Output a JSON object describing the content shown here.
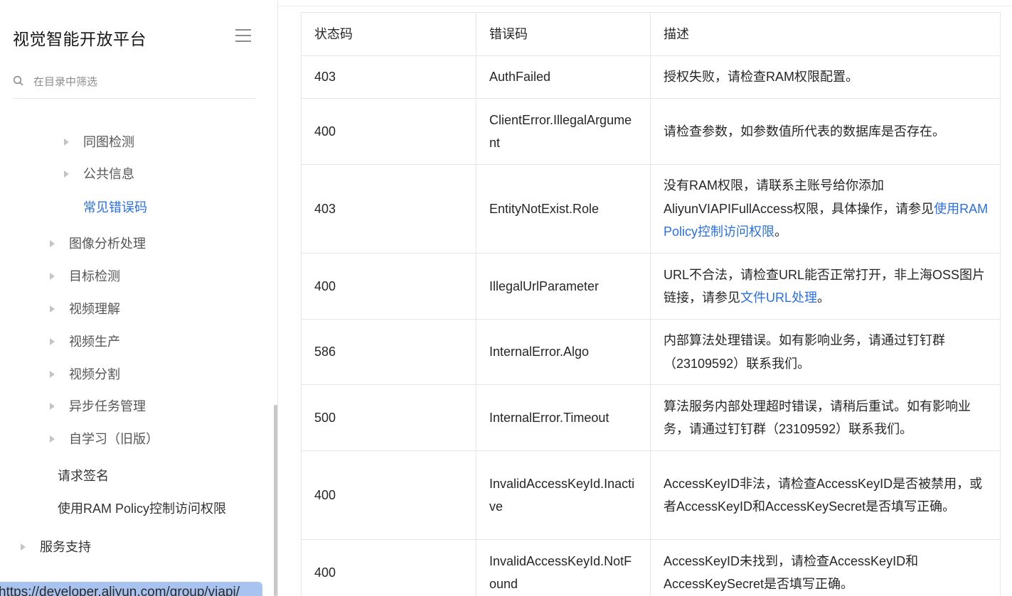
{
  "sidebar": {
    "title": "视觉智能开放平台",
    "search_placeholder": "在目录中筛选",
    "items": [
      {
        "label": "同图检测",
        "has_arrow": true
      },
      {
        "label": "公共信息",
        "has_arrow": true
      },
      {
        "label": "常见错误码",
        "has_arrow": false,
        "active": true
      },
      {
        "label": "图像分析处理",
        "has_arrow": true
      },
      {
        "label": "目标检测",
        "has_arrow": true
      },
      {
        "label": "视频理解",
        "has_arrow": true
      },
      {
        "label": "视频生产",
        "has_arrow": true
      },
      {
        "label": "视频分割",
        "has_arrow": true
      },
      {
        "label": "异步任务管理",
        "has_arrow": true
      },
      {
        "label": "自学习（旧版）",
        "has_arrow": true
      },
      {
        "label": "请求签名",
        "has_arrow": false
      },
      {
        "label": "使用RAM Policy控制访问权限",
        "has_arrow": false
      },
      {
        "label": "服务支持",
        "has_arrow": true
      }
    ],
    "url_tooltip": "https://developer.aliyun.com/group/viapi/"
  },
  "table": {
    "headers": [
      "状态码",
      "错误码",
      "描述"
    ],
    "rows": [
      {
        "status": "403",
        "code": "AuthFailed",
        "desc_pre": "授权失败，请检查RAM权限配置。",
        "link": "",
        "desc_post": ""
      },
      {
        "status": "400",
        "code": "ClientError.IllegalArgument",
        "desc_pre": "请检查参数，如参数值所代表的数据库是否存在。",
        "link": "",
        "desc_post": ""
      },
      {
        "status": "403",
        "code": "EntityNotExist.Role",
        "desc_pre": "没有RAM权限，请联系主账号给你添加AliyunVIAPIFullAccess权限，具体操作，请参见",
        "link": "使用RAM Policy控制访问权限",
        "desc_post": "。"
      },
      {
        "status": "400",
        "code": "IllegalUrlParameter",
        "desc_pre": "URL不合法，请检查URL能否正常打开，非上海OSS图片链接，请参见",
        "link": "文件URL处理",
        "desc_post": "。"
      },
      {
        "status": "586",
        "code": "InternalError.Algo",
        "desc_pre": "内部算法处理错误。如有影响业务，请通过钉钉群（23109592）联系我们。",
        "link": "",
        "desc_post": ""
      },
      {
        "status": "500",
        "code": "InternalError.Timeout",
        "desc_pre": "算法服务内部处理超时错误，请稍后重试。如有影响业务，请通过钉钉群（23109592）联系我们。",
        "link": "",
        "desc_post": ""
      },
      {
        "status": "400",
        "code": "InvalidAccessKeyId.Inactive",
        "desc_pre": "AccessKeyID非法，请检查AccessKeyID是否被禁用，或者AccessKeyID和AccessKeySecret是否填写正确。",
        "link": "",
        "desc_post": ""
      },
      {
        "status": "400",
        "code": "InvalidAccessKeyId.NotFound",
        "desc_pre": "AccessKeyID未找到，请检查AccessKeyID和AccessKeySecret是否填写正确。",
        "link": "",
        "desc_post": ""
      }
    ]
  }
}
